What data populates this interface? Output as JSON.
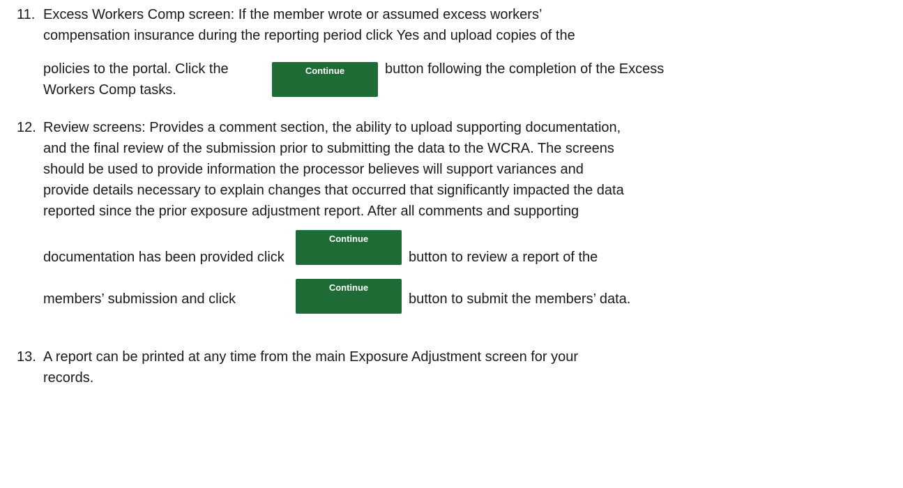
{
  "items": [
    {
      "number": "11.",
      "line1": "Excess Workers Comp screen: If the member wrote or assumed excess workers’",
      "line2": "compensation insurance during the reporting period click Yes and upload copies of the",
      "line3_before": "policies to the portal. Click the",
      "line3_after": "button following the completion of the Excess",
      "line4": "Workers Comp tasks."
    },
    {
      "number": "12.",
      "line1": "Review screens: Provides a comment section, the ability to upload supporting documentation,",
      "line2": "and the final review of the submission prior to submitting the data to the WCRA. The screens",
      "line3": "should be used to provide information the processor believes will support variances and",
      "line4": "provide details necessary to explain changes that occurred that significantly impacted the data",
      "line5": "reported since the prior exposure adjustment report. After all comments and supporting",
      "line6_before": "documentation has been provided click",
      "line6_after": "button to review a report of the",
      "line7_before": "members’ submission and click",
      "line7_after": "button to submit the members’ data."
    },
    {
      "number": "13.",
      "line1": "A report can be printed at any time from the main Exposure Adjustment screen for your",
      "line2": "records."
    }
  ],
  "buttons": {
    "continue_label": "Continue",
    "color": "#1f6b35"
  }
}
